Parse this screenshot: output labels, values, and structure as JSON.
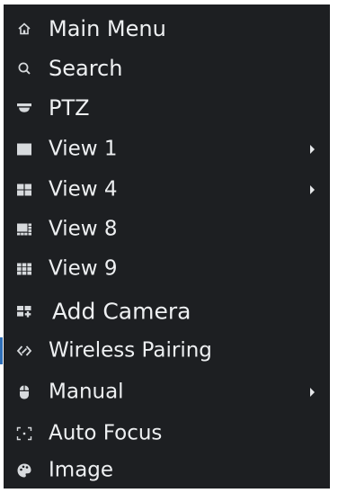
{
  "menu": {
    "items": [
      {
        "label": "Main Menu",
        "icon": "home-icon",
        "has_submenu": false
      },
      {
        "label": "Search",
        "icon": "search-icon",
        "has_submenu": false
      },
      {
        "label": "PTZ",
        "icon": "ptz-dome-icon",
        "has_submenu": false
      },
      {
        "label": "View 1",
        "icon": "view-1-icon",
        "has_submenu": true
      },
      {
        "label": "View 4",
        "icon": "view-4-icon",
        "has_submenu": true
      },
      {
        "label": "View 8",
        "icon": "view-8-icon",
        "has_submenu": false
      },
      {
        "label": "View 9",
        "icon": "view-9-icon",
        "has_submenu": false
      },
      {
        "label": "Add Camera",
        "icon": "add-camera-icon",
        "has_submenu": false
      },
      {
        "label": "Wireless Pairing",
        "icon": "wireless-pairing-icon",
        "has_submenu": false
      },
      {
        "label": "Manual",
        "icon": "mouse-icon",
        "has_submenu": true
      },
      {
        "label": "Auto Focus",
        "icon": "auto-focus-icon",
        "has_submenu": false
      },
      {
        "label": "Image",
        "icon": "image-palette-icon",
        "has_submenu": false
      }
    ]
  },
  "colors": {
    "menu_background": "#1d1f22",
    "text": "#eef0f2",
    "icon": "#d7dadd",
    "focus_accent": "#2f6fb8"
  }
}
